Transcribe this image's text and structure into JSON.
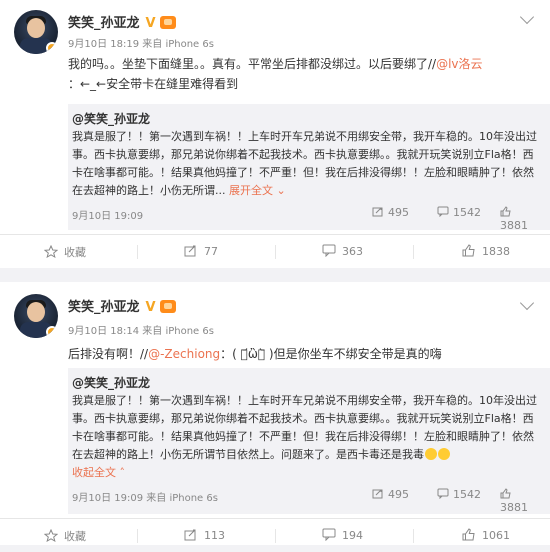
{
  "posts": [
    {
      "author": "笑笑_孙亚龙",
      "verified_mark": "V",
      "meta": "9月10日 18:19 来自 iPhone 6s",
      "text_prefix": "我的吗。。坐垫下面缝里。。真有。平常坐后排都没绑过。以后要绑了//",
      "mention": "@lv洛云",
      "text_line2": "：←_←安全带卡在缝里难得看到",
      "quote": {
        "author": "@笑笑_孙亚龙",
        "body": "我真是服了！！第一次遇到车祸！！上车时开车兄弟说不用绑安全带，我开车稳的。10年没出过事。西卡执意要绑，那兄弟说你绑着不起我技术。西卡执意要绑。。我就开玩笑说别立Fla格！西卡在啥事都可能。！结果真他妈撞了！不严重！但！我在后排没得绑！！左脸和眼睛肿了！依然在去超神的路上！小伤无所谓...",
        "expand": "展开全文",
        "date": "9月10日 19:09",
        "reposts": "495",
        "comments": "1542",
        "likes": "3881"
      },
      "actions": {
        "collect": "收藏",
        "repost": "77",
        "comment": "363",
        "like": "1838"
      }
    },
    {
      "author": "笑笑_孙亚龙",
      "verified_mark": "V",
      "meta": "9月10日 18:14 来自 iPhone 6s",
      "text_prefix": "后排没有啊！//",
      "mention": "@-Zechiong",
      "text_line2": "：( ･᷄ὢ･᷅ )但是你坐车不绑安全带是真的嗨",
      "quote": {
        "author": "@笑笑_孙亚龙",
        "body": "我真是服了！！第一次遇到车祸！！上车时开车兄弟说不用绑安全带，我开车稳的。10年没出过事。西卡执意要绑，那兄弟说你绑着不起我技术。西卡执意要绑。。我就开玩笑说别立Fla格！西卡在啥事都可能。！结果真他妈撞了！不严重！但！我在后排没得绑！！左脸和眼睛肿了！依然在去超神的路上！小伤无所谓节目依然上。问题来了。是西卡毒还是我毒",
        "collapse": "收起全文",
        "date": "9月10日 19:09 来自 iPhone 6s",
        "reposts": "495",
        "comments": "1542",
        "likes": "3881"
      },
      "actions": {
        "collect": "收藏",
        "repost": "113",
        "comment": "194",
        "like": "1061"
      }
    }
  ],
  "icons": {
    "repost": "repost-icon",
    "comment": "comment-icon",
    "like": "like-icon",
    "collect": "star-icon",
    "chevron": "chevron-down-icon"
  },
  "colors": {
    "link": "#eb7350",
    "accent": "#f5a623"
  }
}
